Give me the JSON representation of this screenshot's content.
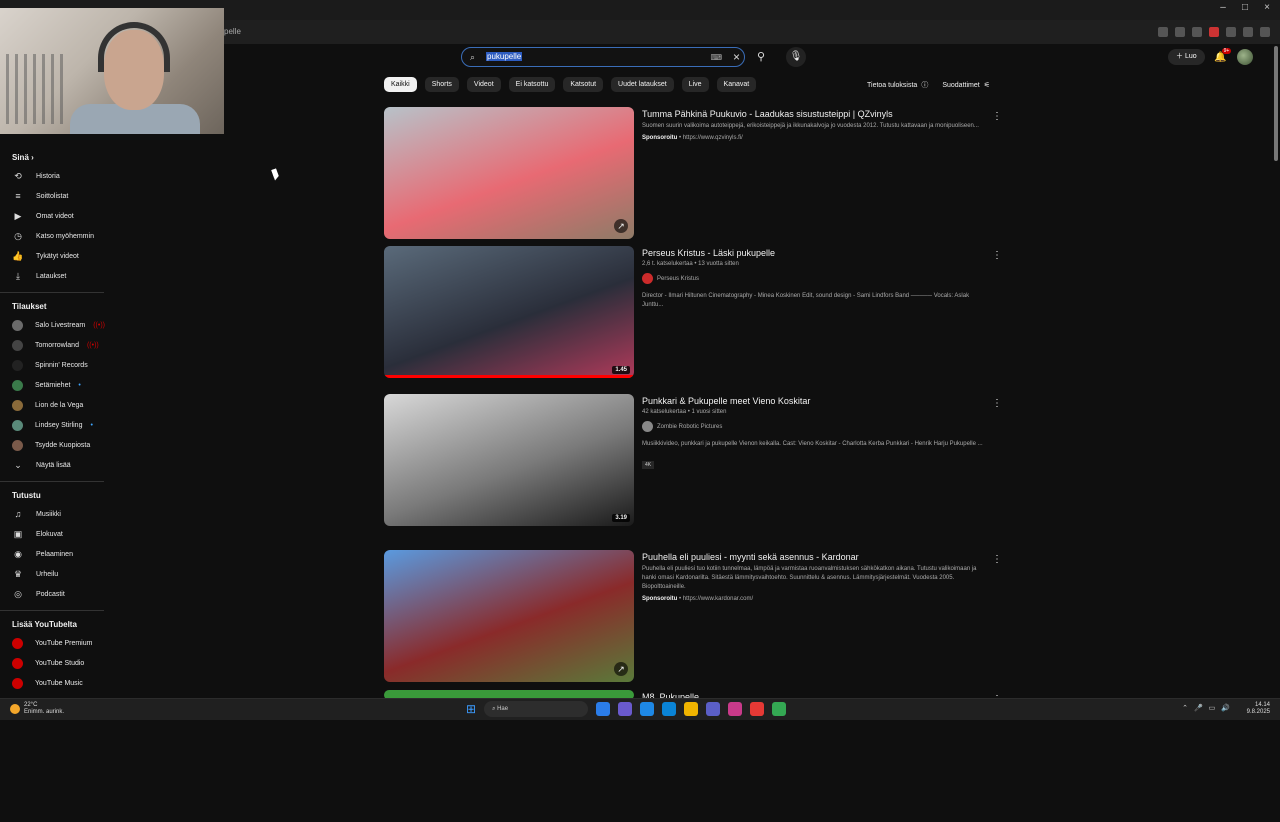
{
  "browser": {
    "address_tail": "pelle",
    "window_controls": [
      "–",
      "□",
      "×"
    ]
  },
  "search": {
    "query": "pukupelle",
    "keyboard_icon": "keyboard-icon",
    "clear_icon": "×"
  },
  "header": {
    "create_label": "Luo",
    "notification_badge": "9+"
  },
  "sidebar": {
    "you_heading": "Sinä",
    "you_items": [
      {
        "label": "Historia",
        "icon": "history-icon",
        "glyph": "⟲"
      },
      {
        "label": "Soittolistat",
        "icon": "playlist-icon",
        "glyph": "≡"
      },
      {
        "label": "Omat videot",
        "icon": "my-videos-icon",
        "glyph": "▶"
      },
      {
        "label": "Katso myöhemmin",
        "icon": "watch-later-icon",
        "glyph": "◷"
      },
      {
        "label": "Tykätyt videot",
        "icon": "thumbs-up-icon",
        "glyph": "👍"
      },
      {
        "label": "Lataukset",
        "icon": "download-icon",
        "glyph": "⤓"
      }
    ],
    "subs_heading": "Tilaukset",
    "subs_items": [
      {
        "label": "Salo Livestream",
        "color": "#6b6b6b",
        "dot": "((•))",
        "dot_color": "#cc0000"
      },
      {
        "label": "Tomorrowland",
        "color": "#444444",
        "dot": "((•))",
        "dot_color": "#cc0000"
      },
      {
        "label": "Spinnin' Records",
        "color": "#222222",
        "dot": "",
        "dot_color": "#cc0000"
      },
      {
        "label": "Setämiehet",
        "color": "#3a7a4a",
        "dot": "•",
        "dot_color": "#3ea6ff"
      },
      {
        "label": "Lion de la Vega",
        "color": "#8a6a3a",
        "dot": "",
        "dot_color": "#3ea6ff"
      },
      {
        "label": "Lindsey Stirling",
        "color": "#5a8a7a",
        "dot": "•",
        "dot_color": "#3ea6ff"
      },
      {
        "label": "Tsydde Kuopiosta",
        "color": "#7a5a4a",
        "dot": "",
        "dot_color": "#3ea6ff"
      }
    ],
    "show_more": "Näytä lisää",
    "explore_heading": "Tutustu",
    "explore_items": [
      {
        "label": "Musiikki",
        "icon": "music-note-icon",
        "glyph": "♫"
      },
      {
        "label": "Elokuvat",
        "icon": "film-icon",
        "glyph": "▣"
      },
      {
        "label": "Pelaaminen",
        "icon": "gamepad-icon",
        "glyph": "◉"
      },
      {
        "label": "Urheilu",
        "icon": "trophy-icon",
        "glyph": "♛"
      },
      {
        "label": "Podcastit",
        "icon": "podcast-icon",
        "glyph": "◎"
      }
    ],
    "more_heading": "Lisää YouTubelta",
    "more_items": [
      {
        "label": "YouTube Premium",
        "color": "#cc0000"
      },
      {
        "label": "YouTube Studio",
        "color": "#cc0000"
      },
      {
        "label": "YouTube Music",
        "color": "#cc0000"
      }
    ]
  },
  "chips": [
    "Kaikki",
    "Shorts",
    "Videot",
    "Ei katsottu",
    "Katsotut",
    "Uudet lataukset",
    "Live",
    "Kanavat"
  ],
  "filters": {
    "about_results": "Tietoa tuloksista",
    "filters_label": "Suodattimet"
  },
  "results": [
    {
      "title": "Tumma Pähkinä Puukuvio - Laadukas sisustusteippi | QZvinyls",
      "desc": "Suomen suurin valikoima autoteippejä, erikoisteippejä ja ikkunakalvoja jo vuodesta 2012. Tutustu kattavaan ja monipuoliseen...",
      "sponsor_label": "Sponsoroitu",
      "sponsor_url": "https://www.qzvinyls.fi/",
      "thumb_colors": [
        "#b7c2c9",
        "#e86a73",
        "#8e7b67"
      ],
      "duration": "",
      "progress": 0
    },
    {
      "title": "Perseus Kristus - Läski pukupelle",
      "sub": "2,6 t. katselukertaa • 13 vuotta sitten",
      "channel": "Perseus Kristus",
      "channel_color": "#cc2b2b",
      "desc": "Director - Ilmari Hiltunen Cinematography - Minea Koskinen Edit, sound design - Sami Lindfors Band ───── Vocals: Aslak Junttu...",
      "thumb_colors": [
        "#5a6a7a",
        "#2a2e3a",
        "#b03a5a"
      ],
      "duration": "1.45",
      "progress": 100
    },
    {
      "title": "Punkkari & Pukupelle meet Vieno Koskitar",
      "sub": "42 katselukertaa • 1 vuosi sitten",
      "channel": "Zombie Robotic Pictures",
      "channel_color": "#888888",
      "desc": "Musiikkivideo, punkkari ja pukupelle Vienon keikalla. Cast: Vieno Koskitar - Charlotta Kerba Punkkari - Henrik Harju Pukupelle ...",
      "tag": "4K",
      "thumb_colors": [
        "#d8d8d8",
        "#7a7a7a",
        "#1a1a1a"
      ],
      "duration": "3.19",
      "progress": 0
    },
    {
      "title": "Puuhella eli puuliesi - myynti sekä asennus - Kardonar",
      "desc": "Puuhella eli puuliesi tuo kotiin tunnelmaa, lämpöä ja varmistaa ruoanvalmistuksen sähkökatkon aikana. Tutustu valikoimaan ja hanki omasi Kardonarilta. Sitäestä lämmitysvaihtoehto. Suunnittelu & asennus. Lämmitysjärjestelmät. Vuodesta 2005. Biopolttoaineille.",
      "sponsor_label": "Sponsoroitu",
      "sponsor_url": "https://www.kardonar.com/",
      "thumb_colors": [
        "#5a9adf",
        "#8a2a2a",
        "#5a7a3a"
      ],
      "duration": "",
      "progress": 0
    },
    {
      "title": "M8. Pukupelle",
      "thumb_colors": [
        "#3a9a3a",
        "#3a9a3a",
        "#3a9a3a"
      ]
    }
  ],
  "taskbar": {
    "temp": "22°C",
    "weather": "Enimm. aurink.",
    "search": "Hae",
    "time": "14.14",
    "date": "9.8.2025",
    "apps": [
      "#2b7de9",
      "#6a5acd",
      "#1e88e5",
      "#0a84d6",
      "#f0b400",
      "#5b5fc7",
      "#c93a8a",
      "#e53935",
      "#34a853"
    ]
  }
}
